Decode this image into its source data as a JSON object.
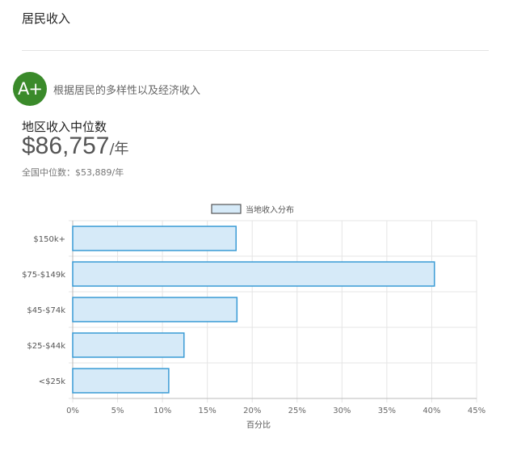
{
  "section_title": "居民收入",
  "grade": {
    "badge": "A+",
    "description": "根据居民的多样性以及经济收入",
    "badge_color": "#3a8a2a"
  },
  "median": {
    "label": "地区收入中位数",
    "amount": "$86,757",
    "unit": "/年",
    "national_label": "全国中位数：$53,889/年"
  },
  "chart_data": {
    "type": "bar",
    "orientation": "horizontal",
    "categories": [
      "$150k+",
      "$75-$149k",
      "$45-$74k",
      "$25-$44k",
      "<$25k"
    ],
    "series": [
      {
        "name": "当地收入分布",
        "values": [
          18.2,
          40.3,
          18.3,
          12.4,
          10.7
        ],
        "color": "#3a9bd5",
        "fill": "#d6eaf8"
      }
    ],
    "xlabel": "百分比",
    "ylabel": "",
    "xlim": [
      0,
      45
    ],
    "xticks": [
      "0%",
      "5%",
      "10%",
      "15%",
      "20%",
      "25%",
      "30%",
      "35%",
      "40%",
      "45%"
    ],
    "grid": true,
    "legend_position": "top"
  }
}
